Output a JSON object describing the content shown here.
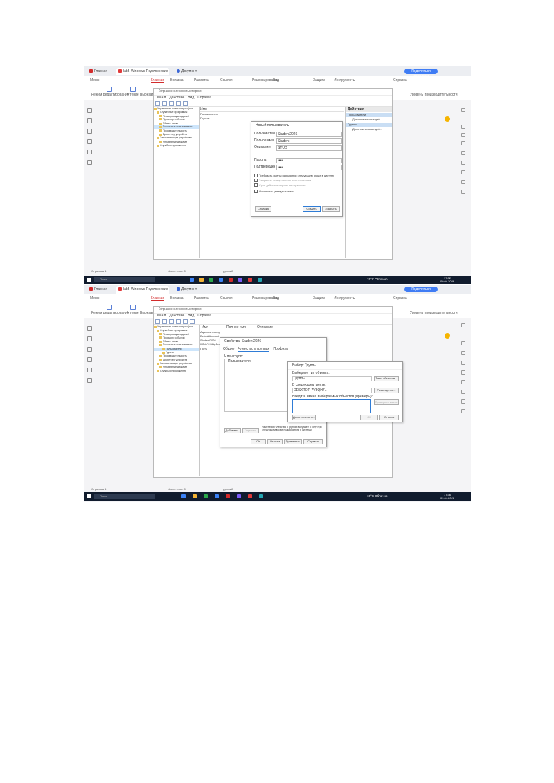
{
  "screens": [
    {
      "browser": {
        "tabs": [
          "Главная",
          "lab5 Windows-Подключение",
          "Документ"
        ],
        "share_button": "Поделиться доступом",
        "menu": [
          "Меню",
          "Главная",
          "Вставка",
          "Разметка",
          "Ссылки",
          "Рецензирование",
          "Вид",
          "Защита",
          "Инструменты",
          "Справка"
        ],
        "ribbon": [
          "Режим редактирования",
          "Чтение",
          "Вырезать",
          "Копировать"
        ],
        "ribbon_right": "Уровень производительности"
      },
      "mmc": {
        "title": "Управление компьютером",
        "menu": [
          "Файл",
          "Действие",
          "Вид",
          "Справка"
        ],
        "tree": [
          "Управление компьютером (лок",
          "Служебные программы",
          "Планировщик заданий",
          "Просмотр событий",
          "Общие папки",
          "Локальные пользователи",
          "Производительность",
          "Диспетчер устройств",
          "Запоминающие устройства",
          "Управление дисками",
          "Службы и приложения"
        ],
        "list_header": "Имя",
        "list_rows": [
          "Пользователи",
          "Группы"
        ],
        "actions_title": "Действия",
        "actions": [
          "Пользователи",
          "Дополнительные дей...",
          "Группы",
          "Дополнительные дей..."
        ]
      },
      "dialog": {
        "title": "Новый пользователь",
        "fields": [
          {
            "label": "Пользователь:",
            "value": "Student2026"
          },
          {
            "label": "Полное имя:",
            "value": "Student"
          },
          {
            "label": "Описание:",
            "value": "STUD"
          },
          {
            "label": "Пароль:",
            "value": "••••"
          },
          {
            "label": "Подтверждение:",
            "value": "••••"
          }
        ],
        "checks": [
          "Требовать смены пароля при следующем входе в систему",
          "Запретить смену пароля пользователем",
          "Срок действия пароля не ограничен",
          "Отключить учетную запись"
        ],
        "buttons": [
          "Справка",
          "Создать",
          "Закрыть"
        ]
      },
      "status": {
        "page": "Страница 1",
        "words": "Число слов: 0",
        "lang": "русский"
      },
      "taskbar": {
        "search": "Поиск",
        "weather": "15°C Облачно",
        "time": "17:32",
        "date": "09.04.2026"
      }
    },
    {
      "browser": {
        "tabs": [
          "Главная",
          "lab5 Windows-Подключение",
          "Документ"
        ],
        "share_button": "Поделиться доступом",
        "menu": [
          "Меню",
          "Главная",
          "Вставка",
          "Разметка",
          "Ссылки",
          "Рецензирование",
          "Вид",
          "Защита",
          "Инструменты",
          "Справка"
        ],
        "ribbon": [
          "Режим редактирования",
          "Чтение",
          "Вырезать",
          "Копировать"
        ],
        "ribbon_right": "Уровень производительности"
      },
      "mmc": {
        "title": "Управление компьютером",
        "menu": [
          "Файл",
          "Действие",
          "Вид",
          "Справка"
        ],
        "tree": [
          "Управление компьютером (лок",
          "Служебные программы",
          "Планировщик заданий",
          "Просмотр событий",
          "Общие папки",
          "Локальные пользователи",
          "Пользователи",
          "Группы",
          "Производительность",
          "Диспетчер устройств",
          "Запоминающие устройства",
          "Управление дисками",
          "Службы и приложения"
        ],
        "list_headers": [
          "Имя",
          "Полное имя",
          "Описание"
        ],
        "list_rows": [
          "Администратор",
          "DefaultAccount",
          "Student2026",
          "WDAGUtilityAccount",
          "Гость"
        ]
      },
      "props_dialog": {
        "title": "Свойства: Student2026",
        "tabs": [
          "Общие",
          "Членство в группах",
          "Профиль"
        ],
        "member_label": "Член групп:",
        "members": [
          "Пользователи"
        ],
        "buttons": [
          "Добавить...",
          "Удалить",
          "OK",
          "Отмена",
          "Применить",
          "Справка"
        ],
        "note": "Изменения членства в группах вступают в силу при следующем входе пользователя в систему."
      },
      "select_dialog": {
        "title": "Выбор: Группы",
        "type_label": "Выберите тип объекта:",
        "type_value": "Группы",
        "type_button": "Типы объектов...",
        "location_label": "В следующем месте:",
        "location_value": "DESKTOP-7V3QH7L",
        "location_button": "Размещение...",
        "names_label": "Введите имена выбираемых объектов (примеры):",
        "check_button": "Проверить имена",
        "buttons": [
          "Дополнительно...",
          "ОК",
          "Отмена"
        ]
      },
      "status": {
        "page": "Страница 1",
        "words": "Число слов: 0",
        "lang": "русский"
      },
      "taskbar": {
        "search": "Поиск",
        "weather": "15°C Облачно",
        "time": "17:36",
        "date": "09.04.2026"
      }
    }
  ]
}
